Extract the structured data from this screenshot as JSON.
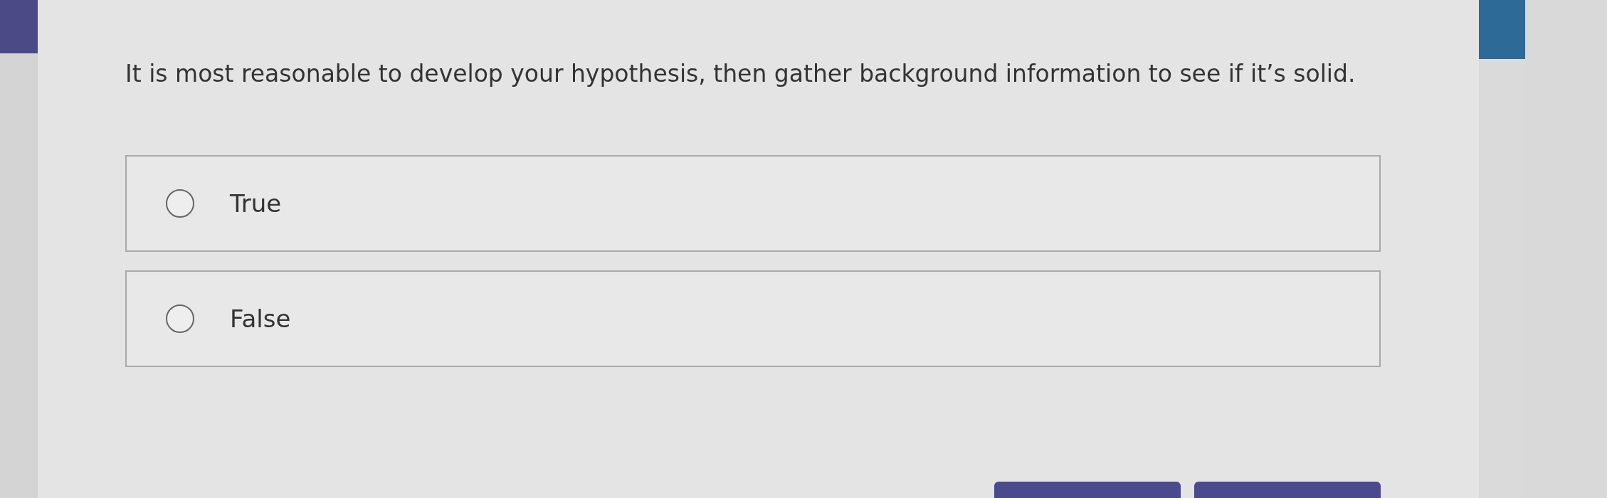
{
  "question": {
    "text": "It is most reasonable to develop your hypothesis, then gather background information to see if it’s solid."
  },
  "options": [
    {
      "label": "True",
      "selected": false
    },
    {
      "label": "False",
      "selected": false
    }
  ],
  "buttons": [
    {
      "kind": "primary"
    },
    {
      "kind": "primary"
    }
  ]
}
